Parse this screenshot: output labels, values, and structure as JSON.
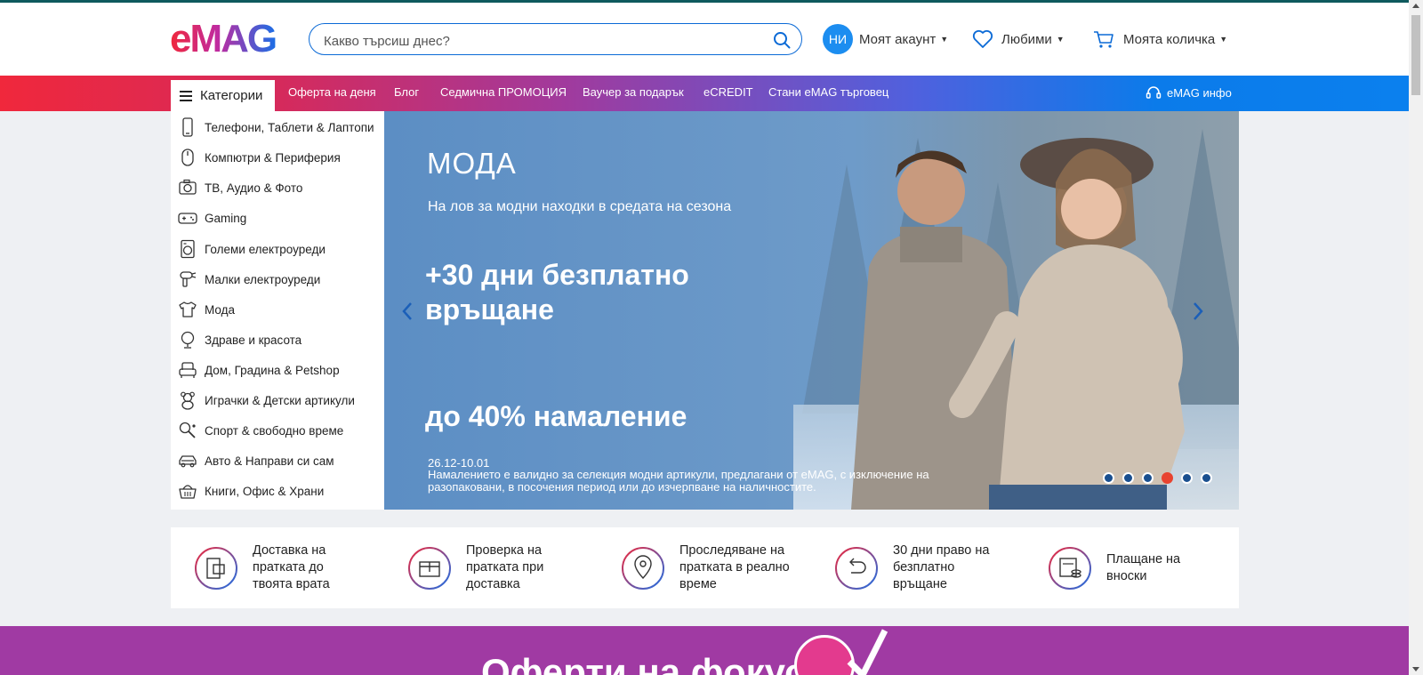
{
  "header": {
    "logo_text": "eMAG",
    "search_placeholder": "Какво търсиш днес?",
    "account": {
      "initials": "НИ",
      "label": "Моят акаунт"
    },
    "favorites_label": "Любими",
    "cart_label": "Моята количка"
  },
  "nav": {
    "categories_label": "Категории",
    "links": [
      "Оферта на деня",
      "Блог",
      "Седмична ПРОМОЦИЯ",
      "Ваучер за подарък",
      "eCREDIT",
      "Стани eMAG търговец"
    ],
    "info_label": "eMAG инфо"
  },
  "categories": [
    {
      "label": "Телефони, Таблети & Лаптопи",
      "icon": "phone-icon"
    },
    {
      "label": "Компютри & Периферия",
      "icon": "mouse-icon"
    },
    {
      "label": "ТВ, Аудио & Фото",
      "icon": "camera-icon"
    },
    {
      "label": "Gaming",
      "icon": "gamepad-icon"
    },
    {
      "label": "Големи електроуреди",
      "icon": "washing-machine-icon"
    },
    {
      "label": "Малки електроуреди",
      "icon": "hair-dryer-icon"
    },
    {
      "label": "Мода",
      "icon": "tshirt-icon"
    },
    {
      "label": "Здраве и красота",
      "icon": "mirror-icon"
    },
    {
      "label": "Дом, Градина & Petshop",
      "icon": "armchair-icon"
    },
    {
      "label": "Играчки & Детски артикули",
      "icon": "teddy-bear-icon"
    },
    {
      "label": "Спорт & свободно време",
      "icon": "racket-icon"
    },
    {
      "label": "Авто & Направи си сам",
      "icon": "car-icon"
    },
    {
      "label": "Книги, Офис & Храни",
      "icon": "basket-icon"
    }
  ],
  "banner": {
    "title": "МОДА",
    "subtitle": "На лов за модни находки в средата на сезона",
    "headline1": "+30 дни безплатно връщане",
    "headline2": "до 40% намаление",
    "date": "26.12-10.01",
    "note": "Намалението е валидно за селекция модни артикули, предлагани от eMAG, с изключение на разопаковани, в посочения период или до изчерпване на наличностите.",
    "slide_count": 6,
    "active_slide": 4
  },
  "benefits": [
    {
      "text": "Доставка на пратката до твоята врата",
      "icon": "door-delivery-icon"
    },
    {
      "text": "Проверка на пратката при доставка",
      "icon": "open-box-icon"
    },
    {
      "text": "Проследяване на пратката в реално време",
      "icon": "map-pin-icon"
    },
    {
      "text": "30 дни право на безплатно връщане",
      "icon": "return-arrow-icon"
    },
    {
      "text": "Плащане на вноски",
      "icon": "installments-icon"
    }
  ],
  "promo": {
    "title": "Оферти на фокус"
  },
  "colors": {
    "brand_blue": "#0b6ad6",
    "brand_red": "#f0283c",
    "accent_purple": "#a03aa3"
  }
}
